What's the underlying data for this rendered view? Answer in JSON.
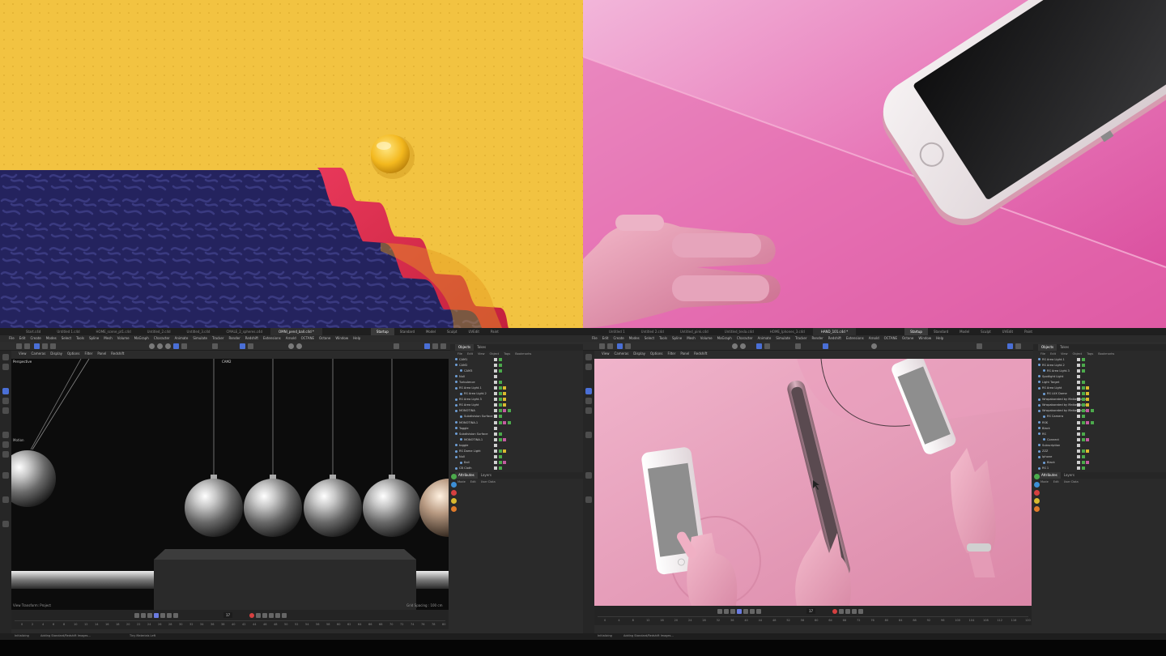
{
  "left_app": {
    "tabs": [
      "Start.c4d",
      "Untitled 1.c4d",
      "HOME_scene_pt1.c4d",
      "Untitled_2.c4d",
      "Untitled_3.c4d",
      "Untitled 4.c4d",
      "CMALE_2_spheres.c4d",
      "OMNI_pend_ball.c4d *"
    ],
    "active_tab": "OMNI_pend_ball.c4d *",
    "layouts": [
      "Startup",
      "Standard",
      "Model",
      "Sculpt",
      "UVEdit",
      "Paint",
      "Anim"
    ],
    "active_layout": "Startup",
    "menu": [
      "File",
      "Edit",
      "Create",
      "Modes",
      "Select",
      "Tools",
      "Spline",
      "Mesh",
      "Volume",
      "MoGraph",
      "Character",
      "Animate",
      "Simulate",
      "Tracker",
      "Render",
      "Redshift",
      "Extensions",
      "Arnold",
      "OCTANE",
      "Octane",
      "Window",
      "Help"
    ],
    "viewport_menu": [
      "View",
      "Cameras",
      "Display",
      "Options",
      "Filter",
      "Panel",
      "Redshift"
    ],
    "viewport_label": "Perspective",
    "camera_label": "CAM2",
    "motion_label": "Motion",
    "viewport_status": "View Transform: Project",
    "grid_spacing": "Grid Spacing : 100 cm",
    "object_panel": {
      "tabs": [
        "Objects",
        "Takes"
      ],
      "menu": [
        "File",
        "Edit",
        "View",
        "Object",
        "Tags",
        "Bookmarks"
      ],
      "rows": [
        "CAM1",
        "CAM2",
        "CAM3",
        "Null",
        "Turbulence",
        "RS Area Light.1",
        "RS Area Light.2",
        "RS Area Light.3",
        "RS Area Light",
        "MONOTINA",
        "Subdivision Surface",
        "MONOTINA.1",
        "Toggle",
        "Subdivision Surface",
        "MONOTINA.1",
        "toggle",
        "RS Dome Light",
        "Null",
        "Ball",
        "CB Cloth"
      ]
    },
    "attr_tabs": [
      "Attributes",
      "Layers"
    ],
    "attr_menu": [
      "Mode",
      "Edit",
      "User Data"
    ],
    "timeline": {
      "frame": "17",
      "start": "0 F",
      "end": "90 F",
      "current": "0 F",
      "ticks": [
        "0",
        "2",
        "4",
        "6",
        "8",
        "10",
        "12",
        "14",
        "16",
        "18",
        "20",
        "22",
        "24",
        "26",
        "28",
        "30",
        "32",
        "34",
        "36",
        "38",
        "40",
        "42",
        "44",
        "46",
        "48",
        "50",
        "52",
        "54",
        "56",
        "58",
        "60",
        "62",
        "64",
        "66",
        "68",
        "70",
        "72",
        "74",
        "76",
        "78",
        "80"
      ]
    },
    "status": "Initializing",
    "status2": "Adding Standard/Redshift Images...",
    "status3": "Tiny Materials Left"
  },
  "right_app": {
    "tabs": [
      "Untitled 1",
      "Untitled 2.c4d",
      "Untitled_pink.c4d",
      "Ubuntu_shares_3.c4d",
      "Untitled_tesla.c4d",
      "Untitled_hand.c4d",
      "HOME_Iphones_3.c4d",
      "Untitled 5.c4d",
      "HAND_101.c4d *"
    ],
    "active_tab": "HAND_101.c4d *",
    "layouts": [
      "Startup",
      "Standard",
      "Model",
      "Sculpt",
      "UVEdit",
      "Paint",
      "Anim"
    ],
    "active_layout": "Startup",
    "menu": [
      "File",
      "Edit",
      "Create",
      "Modes",
      "Select",
      "Tools",
      "Spline",
      "Mesh",
      "Volume",
      "MoGraph",
      "Character",
      "Animate",
      "Simulate",
      "Tracker",
      "Render",
      "Redshift",
      "Extensions",
      "Arnold",
      "OCTANE",
      "Octane",
      "Window",
      "Help"
    ],
    "viewport_menu": [
      "View",
      "Cameras",
      "Display",
      "Options",
      "Filter",
      "Panel",
      "Redshift"
    ],
    "object_panel": {
      "tabs": [
        "Objects",
        "Takes"
      ],
      "menu": [
        "File",
        "Edit",
        "View",
        "Object",
        "Tags",
        "Bookmarks"
      ],
      "rows": [
        "RS Area Light.1",
        "RS Area Light.2",
        "RS Area Light.3",
        "Spotlight Light",
        "Light Target",
        "RS Area Light",
        "RS LUX Dome",
        "Wrapaborated by Matias Tomo.1",
        "Wrapaborated by Matias Tomo.2",
        "Wrapaborated by Matias Tomo.3",
        "RS Camera",
        "RSK",
        "Black",
        "RS",
        "Connect",
        "Subscription",
        "ZZZ",
        "Iphone",
        "Black",
        "RS 1"
      ]
    },
    "attr_tabs": [
      "Attributes",
      "Layers"
    ],
    "attr_menu": [
      "Mode",
      "Edit",
      "User Data"
    ],
    "timeline": {
      "frame": "17",
      "start": "0 F",
      "end": "120 F",
      "current": "0 F",
      "ticks": [
        "0",
        "4",
        "8",
        "12",
        "16",
        "20",
        "24",
        "28",
        "32",
        "36",
        "40",
        "44",
        "48",
        "52",
        "56",
        "60",
        "64",
        "68",
        "72",
        "76",
        "80",
        "84",
        "88",
        "92",
        "96",
        "100",
        "104",
        "108",
        "112",
        "116",
        "120"
      ]
    },
    "status": "Initializing",
    "status2": "Adding Standard/Redshift Images..."
  },
  "colors": {
    "yellow": "#f2c341",
    "navy": "#24235e",
    "red_steps": "#d8304f",
    "pink_bg": "#e55ea6",
    "pink_hand": "#e29bb3",
    "c4d_panel": "#2b2b2b",
    "c4d_accent": "#4a6fd6"
  }
}
